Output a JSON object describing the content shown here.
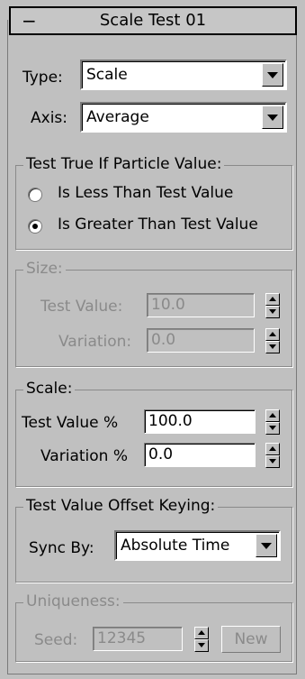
{
  "rollout": {
    "title": "Scale Test 01",
    "collapse_symbol": "−"
  },
  "type": {
    "label": "Type:",
    "value": "Scale"
  },
  "axis": {
    "label": "Axis:",
    "value": "Average"
  },
  "test_true": {
    "legend": "Test True If Particle Value:",
    "options": [
      {
        "label": "Is Less Than Test Value",
        "checked": false
      },
      {
        "label": "Is Greater Than Test Value",
        "checked": true
      }
    ]
  },
  "size": {
    "legend": "Size:",
    "test_value_label": "Test Value:",
    "test_value": "10.0",
    "variation_label": "Variation:",
    "variation": "0.0"
  },
  "scale": {
    "legend": "Scale:",
    "test_value_label": "Test Value %",
    "test_value": "100.0",
    "variation_label": "Variation %",
    "variation": "0.0"
  },
  "offset_keying": {
    "legend": "Test Value Offset Keying:",
    "sync_label": "Sync By:",
    "sync_value": "Absolute Time"
  },
  "uniqueness": {
    "legend": "Uniqueness:",
    "seed_label": "Seed:",
    "seed_value": "12345",
    "new_label": "New"
  }
}
